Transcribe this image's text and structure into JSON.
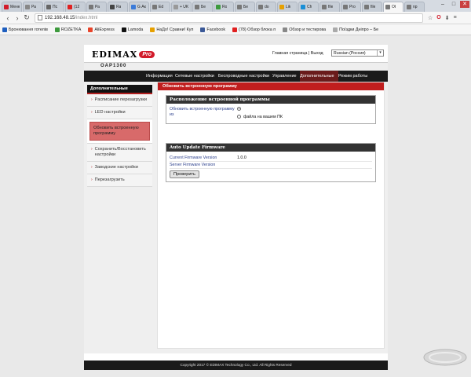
{
  "browser": {
    "tabs": [
      {
        "title": "Меню",
        "color": "#d21b2a"
      },
      {
        "title": "Ра",
        "color": "#888888"
      },
      {
        "title": "Пс",
        "color": "#666666"
      },
      {
        "title": "(12",
        "color": "#e02020"
      },
      {
        "title": "Ра",
        "color": "#777777"
      },
      {
        "title": "Ra",
        "color": "#444444"
      },
      {
        "title": "G Ак",
        "color": "#3b7bd9"
      },
      {
        "title": "Ed",
        "color": "#777777"
      },
      {
        "title": "+ UK",
        "color": "#999999"
      },
      {
        "title": "Бе",
        "color": "#777777"
      },
      {
        "title": "Ro",
        "color": "#3d9a3d"
      },
      {
        "title": "Бе",
        "color": "#777777"
      },
      {
        "title": "do",
        "color": "#777777"
      },
      {
        "title": "Lik",
        "color": "#e6a000"
      },
      {
        "title": "Ch",
        "color": "#1a8fd6"
      },
      {
        "title": "file",
        "color": "#777777"
      },
      {
        "title": "Pro",
        "color": "#777777"
      },
      {
        "title": "file",
        "color": "#777777"
      },
      {
        "title": "Ot",
        "color": "#777777",
        "active": true
      },
      {
        "title": "np",
        "color": "#777777"
      }
    ],
    "url_host": "192.168.48.15",
    "url_path": "/index.html",
    "bookmarks": [
      {
        "label": "Бронювання готелів",
        "color": "#1f5fbf"
      },
      {
        "label": "ROZETKA",
        "color": "#3d9a3d"
      },
      {
        "label": "AliExpress",
        "color": "#e8442a"
      },
      {
        "label": "Lamoda",
        "color": "#111111"
      },
      {
        "label": "НаДо! Сравни! Куп",
        "color": "#e6a000"
      },
      {
        "label": "Facebook",
        "color": "#3b5998"
      },
      {
        "label": "(78) Обзор блока п",
        "color": "#e02020"
      },
      {
        "label": "Обзор и тестирова",
        "color": "#888888"
      },
      {
        "label": "Поїздки Дніпро – Бе",
        "color": "#aaaaaa"
      }
    ]
  },
  "header": {
    "logo": "EDIMAX",
    "logo_badge": "Pro",
    "links": "Главная страница | Выход",
    "language": "Russian (Россия)",
    "model": "OAP1300"
  },
  "nav": [
    {
      "label": "Информация"
    },
    {
      "label": "Сетевые настройки"
    },
    {
      "label": "Беспроводные настройки"
    },
    {
      "label": "Управление"
    },
    {
      "label": "Дополнительные",
      "active": true
    },
    {
      "label": "Режим работы"
    }
  ],
  "sidebar": {
    "title": "Дополнительные",
    "items": [
      {
        "label": "Расписание перезагрузки"
      },
      {
        "label": "LED настройки"
      },
      {
        "label": "Обновить встроенную программу",
        "active": true
      },
      {
        "label": "Сохранить/Восстановить настройки"
      },
      {
        "label": "Заводские настройки"
      },
      {
        "label": "Перезагрузить"
      }
    ]
  },
  "main": {
    "title": "Обновить встроенную программу",
    "location_section": {
      "title": "Расположение встроенной программы",
      "label": "Обновить встроенную программу из",
      "option_selected": "",
      "option_file": "файла на вашем ПК"
    },
    "auto_section": {
      "title": "Auto Update Firmware",
      "current_label": "Current Firmware Version",
      "current_value": "1.0.0",
      "server_label": "Server Firmware Version",
      "server_value": "",
      "check_button": "Проверить"
    }
  },
  "footer": "Copyright 2017 © EDIMAX Technology Co., Ltd. All Rights Reserved"
}
